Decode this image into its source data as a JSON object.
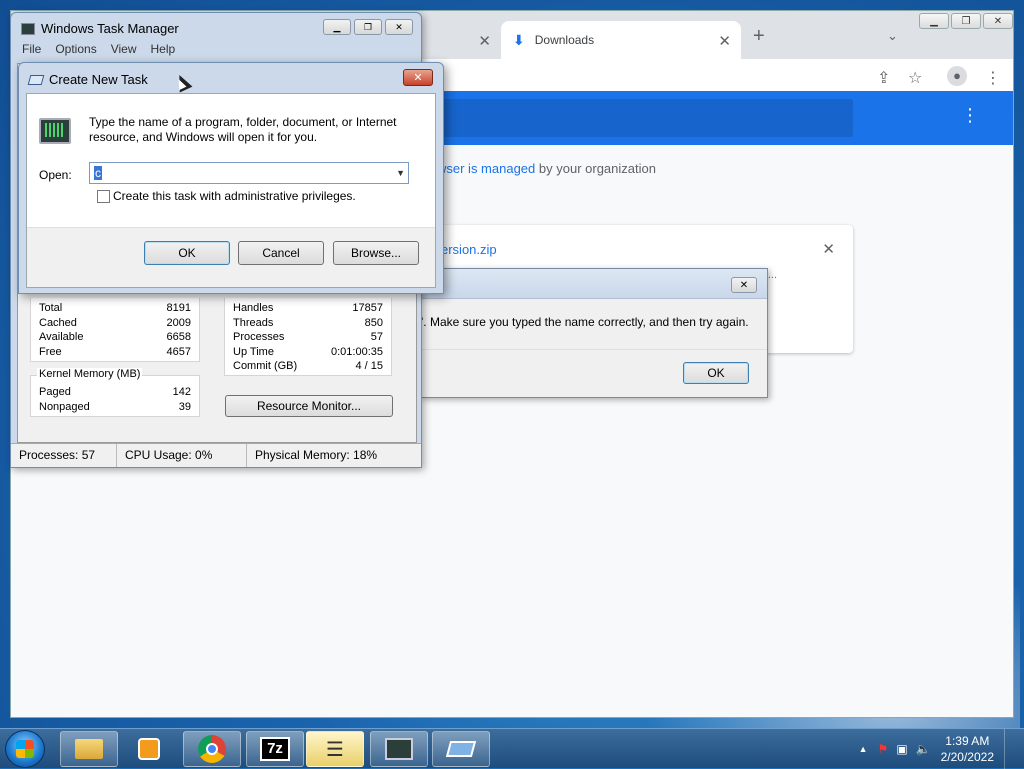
{
  "chrome": {
    "tab_downloads": "Downloads",
    "tab_close": "✕",
    "new_tab": "+",
    "managed_prefix": "wser is managed",
    "managed_suffix": " by your organization",
    "download_filename": "ersion.zip",
    "download_dots": "...",
    "close_icon": "✕"
  },
  "error_dialog": {
    "message": "'. Make sure you typed the name correctly, and then try again.",
    "ok_label": "OK"
  },
  "task_manager": {
    "title": "Windows Task Manager",
    "menu": [
      "File",
      "Options",
      "View",
      "Help"
    ],
    "physical_memory": [
      {
        "label": "Total",
        "value": "8191"
      },
      {
        "label": "Cached",
        "value": "2009"
      },
      {
        "label": "Available",
        "value": "6658"
      },
      {
        "label": "Free",
        "value": "4657"
      }
    ],
    "system": [
      {
        "label": "Handles",
        "value": "17857"
      },
      {
        "label": "Threads",
        "value": "850"
      },
      {
        "label": "Processes",
        "value": "57"
      },
      {
        "label": "Up Time",
        "value": "0:01:00:35"
      },
      {
        "label": "Commit (GB)",
        "value": "4 / 15"
      }
    ],
    "kernel_memory_title": "Kernel Memory (MB)",
    "kernel_memory": [
      {
        "label": "Paged",
        "value": "142"
      },
      {
        "label": "Nonpaged",
        "value": "39"
      }
    ],
    "resource_monitor_label": "Resource Monitor...",
    "status_processes": "Processes: 57",
    "status_cpu": "CPU Usage: 0%",
    "status_memory": "Physical Memory: 18%"
  },
  "create_task": {
    "title": "Create New Task",
    "description": "Type the name of a program, folder, document, or Internet resource, and Windows will open it for you.",
    "open_label": "Open:",
    "open_value": "c",
    "admin_checkbox_label": "Create this task with administrative privileges.",
    "admin_checked": false,
    "ok_label": "OK",
    "cancel_label": "Cancel",
    "browse_label": "Browse...",
    "close_glyph": "✕"
  },
  "taskbar": {
    "time": "1:39 AM",
    "date": "2/20/2022",
    "seven_zip_label": "7z",
    "up_arrow": "▲"
  }
}
